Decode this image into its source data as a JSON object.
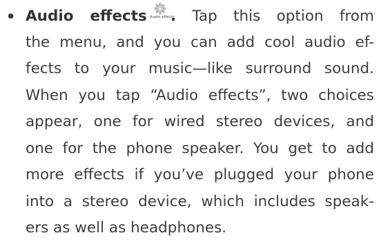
{
  "item": {
    "bullet": "•",
    "term": "Audio effects",
    "icon": {
      "name": "gear-icon",
      "caption": "Audio effects"
    },
    "term_end": ".",
    "lines": [
      " Tap this option from",
      "the menu, and you can add cool audio ef-",
      "fects to your music—like surround sound.",
      "When you tap “Audio effects”, two choices",
      "appear, one for wired stereo devices, and",
      "one for the phone speaker. You get to add",
      "more effects if you’ve plugged your phone",
      "into a stereo device, which includes speak-",
      "ers as well as headphones."
    ]
  }
}
